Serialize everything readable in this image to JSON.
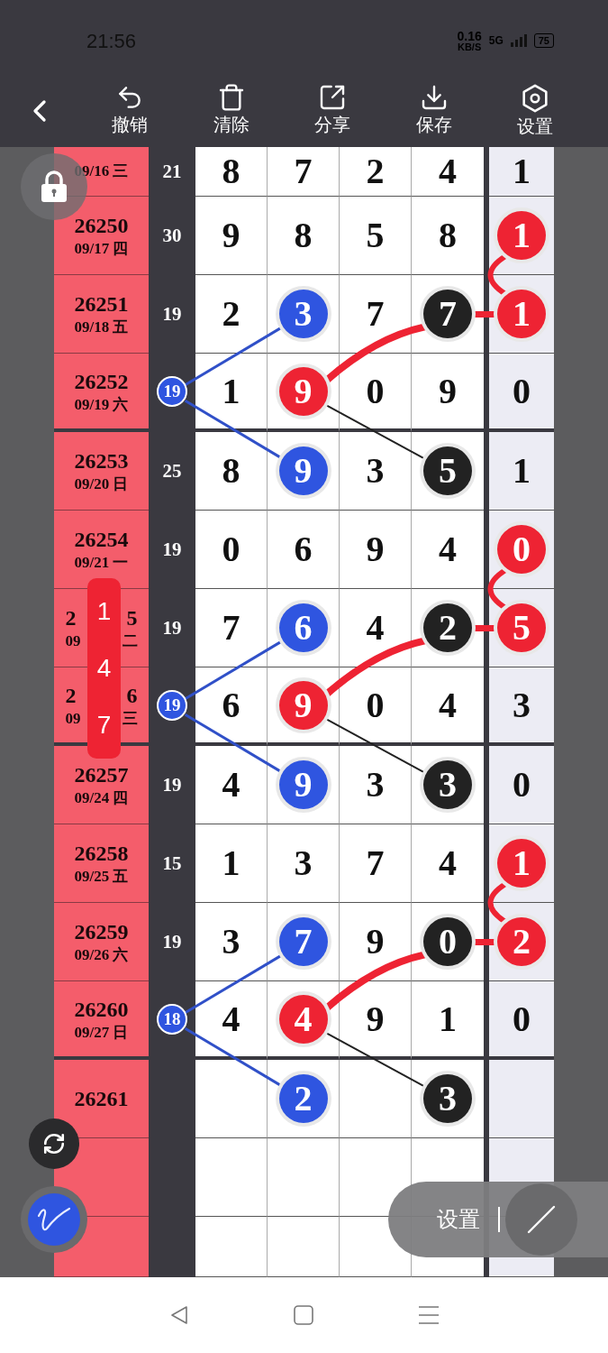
{
  "status_bar": {
    "time": "21:56",
    "network_speed": "0.16",
    "network_unit": "KB/S",
    "network_type": "5G",
    "battery": "75"
  },
  "toolbar": {
    "items": [
      {
        "kind": "undo",
        "label": "撤销"
      },
      {
        "kind": "clear",
        "label": "清除"
      },
      {
        "kind": "share",
        "label": "分享"
      },
      {
        "kind": "save",
        "label": "保存"
      },
      {
        "kind": "settings",
        "label": "设置"
      }
    ]
  },
  "table": {
    "rows": [
      {
        "date": "09/16 三",
        "sum": "21",
        "sum_marked": false,
        "digits": [
          {
            "value": "8",
            "circled": false
          },
          {
            "value": "7",
            "circled": false
          },
          {
            "value": "2",
            "circled": false
          },
          {
            "value": "4",
            "circled": false
          }
        ],
        "last": {
          "value": "1",
          "circled": false
        }
      },
      {
        "issue": "26250",
        "date": "09/17 四",
        "sum": "30",
        "sum_marked": false,
        "digits": [
          {
            "value": "9",
            "circled": false
          },
          {
            "value": "8",
            "circled": false
          },
          {
            "value": "5",
            "circled": false
          },
          {
            "value": "8",
            "circled": false
          }
        ],
        "last": {
          "value": "1",
          "circled": true
        }
      },
      {
        "issue": "26251",
        "date": "09/18 五",
        "sum": "19",
        "sum_marked": false,
        "digits": [
          {
            "value": "2",
            "circled": false
          },
          {
            "value": "3",
            "circled": true,
            "color": "#2f55e0"
          },
          {
            "value": "7",
            "circled": false
          },
          {
            "value": "7",
            "circled": true,
            "color": "#222222"
          }
        ],
        "last": {
          "value": "1",
          "circled": true
        }
      },
      {
        "issue": "26252",
        "date": "09/19 六",
        "sum": "19",
        "sum_marked": true,
        "digits": [
          {
            "value": "1",
            "circled": false
          },
          {
            "value": "9",
            "circled": true,
            "color": "#ee2333"
          },
          {
            "value": "0",
            "circled": false
          },
          {
            "value": "9",
            "circled": false
          }
        ],
        "last": {
          "value": "0",
          "circled": false
        }
      },
      {
        "issue": "26253",
        "date": "09/20 日",
        "sum": "25",
        "sum_marked": false,
        "digits": [
          {
            "value": "8",
            "circled": false
          },
          {
            "value": "9",
            "circled": true,
            "color": "#2f55e0"
          },
          {
            "value": "3",
            "circled": false
          },
          {
            "value": "5",
            "circled": true,
            "color": "#222222"
          }
        ],
        "last": {
          "value": "1",
          "circled": false
        }
      },
      {
        "issue": "26254",
        "date": "09/21 一",
        "sum": "19",
        "sum_marked": false,
        "digits": [
          {
            "value": "0",
            "circled": false
          },
          {
            "value": "6",
            "circled": false
          },
          {
            "value": "9",
            "circled": false
          },
          {
            "value": "4",
            "circled": false
          }
        ],
        "last": {
          "value": "0",
          "circled": true
        }
      },
      {
        "issue_parts": [
          "2",
          "5"
        ],
        "date_parts": [
          "09",
          "二"
        ],
        "sum": "19",
        "sum_marked": false,
        "digits": [
          {
            "value": "7",
            "circled": false
          },
          {
            "value": "6",
            "circled": true,
            "color": "#2f55e0"
          },
          {
            "value": "4",
            "circled": false
          },
          {
            "value": "2",
            "circled": true,
            "color": "#222222"
          }
        ],
        "last": {
          "value": "5",
          "circled": true
        }
      },
      {
        "issue_parts": [
          "2",
          "6"
        ],
        "date_parts": [
          "09",
          "三"
        ],
        "sum": "19",
        "sum_marked": true,
        "digits": [
          {
            "value": "6",
            "circled": false
          },
          {
            "value": "9",
            "circled": true,
            "color": "#ee2333"
          },
          {
            "value": "0",
            "circled": false
          },
          {
            "value": "4",
            "circled": false
          }
        ],
        "last": {
          "value": "3",
          "circled": false
        }
      },
      {
        "issue": "26257",
        "date": "09/24 四",
        "sum": "19",
        "sum_marked": false,
        "digits": [
          {
            "value": "4",
            "circled": false
          },
          {
            "value": "9",
            "circled": true,
            "color": "#2f55e0"
          },
          {
            "value": "3",
            "circled": false
          },
          {
            "value": "3",
            "circled": true,
            "color": "#222222"
          }
        ],
        "last": {
          "value": "0",
          "circled": false
        }
      },
      {
        "issue": "26258",
        "date": "09/25 五",
        "sum": "15",
        "sum_marked": false,
        "digits": [
          {
            "value": "1",
            "circled": false
          },
          {
            "value": "3",
            "circled": false
          },
          {
            "value": "7",
            "circled": false
          },
          {
            "value": "4",
            "circled": false
          }
        ],
        "last": {
          "value": "1",
          "circled": true
        }
      },
      {
        "issue": "26259",
        "date": "09/26 六",
        "sum": "19",
        "sum_marked": false,
        "digits": [
          {
            "value": "3",
            "circled": false
          },
          {
            "value": "7",
            "circled": true,
            "color": "#2f55e0"
          },
          {
            "value": "9",
            "circled": false
          },
          {
            "value": "0",
            "circled": true,
            "color": "#222222"
          }
        ],
        "last": {
          "value": "2",
          "circled": true
        }
      },
      {
        "issue": "26260",
        "date": "09/27 日",
        "sum": "18",
        "sum_marked": true,
        "digits": [
          {
            "value": "4",
            "circled": false
          },
          {
            "value": "4",
            "circled": true,
            "color": "#ee2333"
          },
          {
            "value": "9",
            "circled": false
          },
          {
            "value": "1",
            "circled": false
          }
        ],
        "last": {
          "value": "0",
          "circled": false
        }
      },
      {
        "issue": "26261",
        "digits": [
          {
            "circled": false
          },
          {
            "value": "2",
            "circled": true,
            "color": "#2f55e0"
          },
          {
            "circled": false
          },
          {
            "value": "3",
            "circled": true,
            "color": "#222222"
          }
        ]
      }
    ]
  },
  "picker": {
    "values": [
      "1",
      "4",
      "7"
    ]
  },
  "floating_menu": {
    "label": "设置"
  }
}
